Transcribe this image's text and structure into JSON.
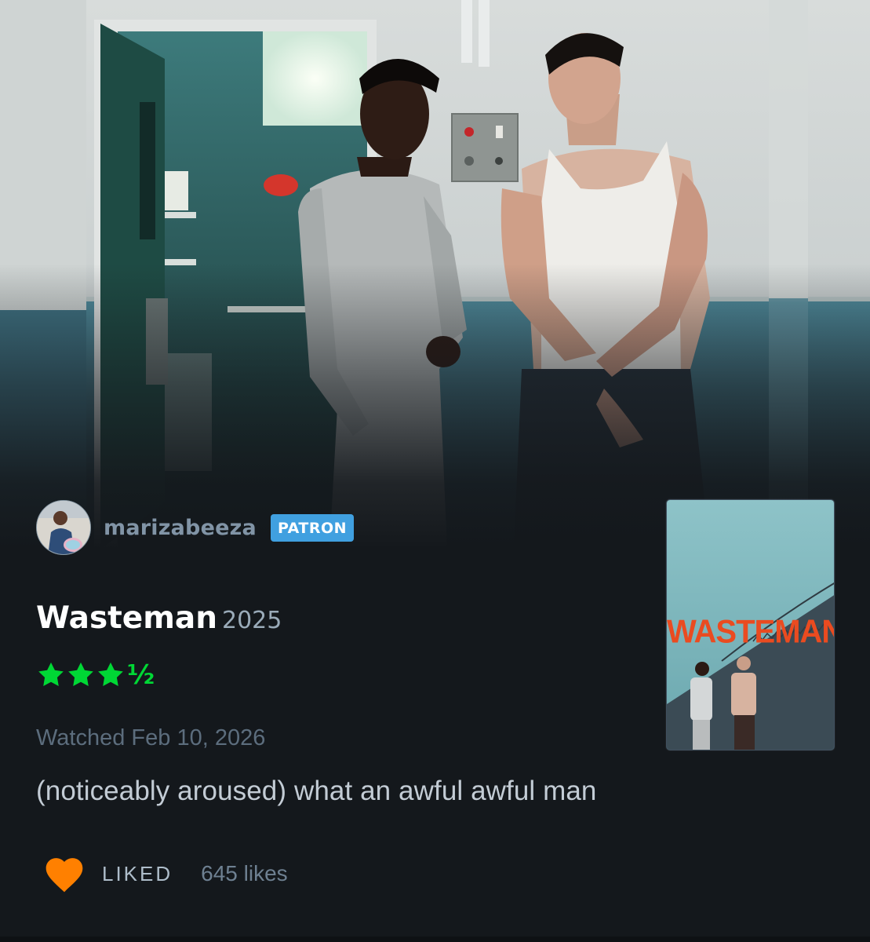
{
  "review": {
    "username": "marizabeeza",
    "badge": "PATRON",
    "film_title": "Wasteman",
    "film_year": "2025",
    "rating_stars": 3.5,
    "rating_half_glyph": "½",
    "watched": "Watched Feb 10, 2026",
    "text": "(noticeably aroused) what an awful awful man",
    "liked_label": "LIKED",
    "likes_count": "645 likes"
  },
  "poster": {
    "title": "WASTEMAN"
  },
  "colors": {
    "background": "#14181c",
    "username": "#8194a6",
    "patron_badge": "#40a0e0",
    "star_green": "#00d735",
    "heart_orange": "#ff8000",
    "poster_title": "#ea4b20"
  },
  "icons": {
    "rating": "star-icon",
    "liked": "heart-icon"
  }
}
